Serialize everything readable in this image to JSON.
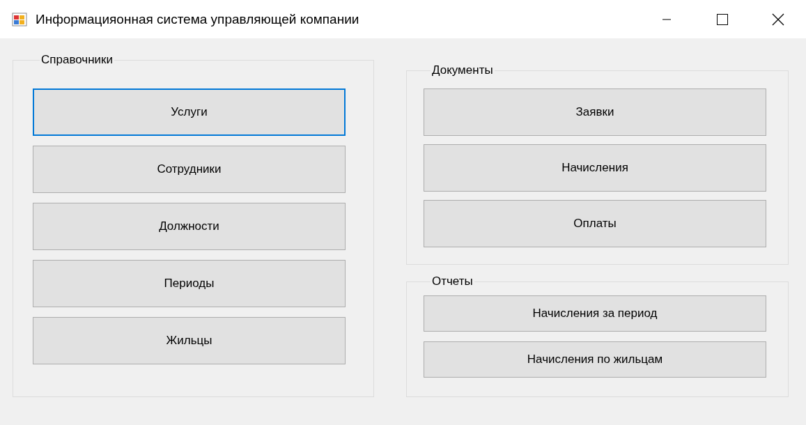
{
  "window": {
    "title": "Информацияонная система управляющей компании"
  },
  "columns": [
    {
      "groups": [
        {
          "title": "Справочники",
          "buttons": [
            {
              "label": "Услуги",
              "focused": true
            },
            {
              "label": "Сотрудники",
              "focused": false
            },
            {
              "label": "Должности",
              "focused": false
            },
            {
              "label": "Периоды",
              "focused": false
            },
            {
              "label": "Жильцы",
              "focused": false
            }
          ]
        }
      ]
    },
    {
      "groups": [
        {
          "title": "Документы",
          "buttons": [
            {
              "label": "Заявки",
              "focused": false
            },
            {
              "label": "Начисления",
              "focused": false
            },
            {
              "label": "Оплаты",
              "focused": false
            }
          ]
        },
        {
          "title": "Отчеты",
          "buttons": [
            {
              "label": "Начисления за период",
              "focused": false
            },
            {
              "label": "Начисления по жильцам",
              "focused": false
            }
          ]
        }
      ]
    }
  ]
}
